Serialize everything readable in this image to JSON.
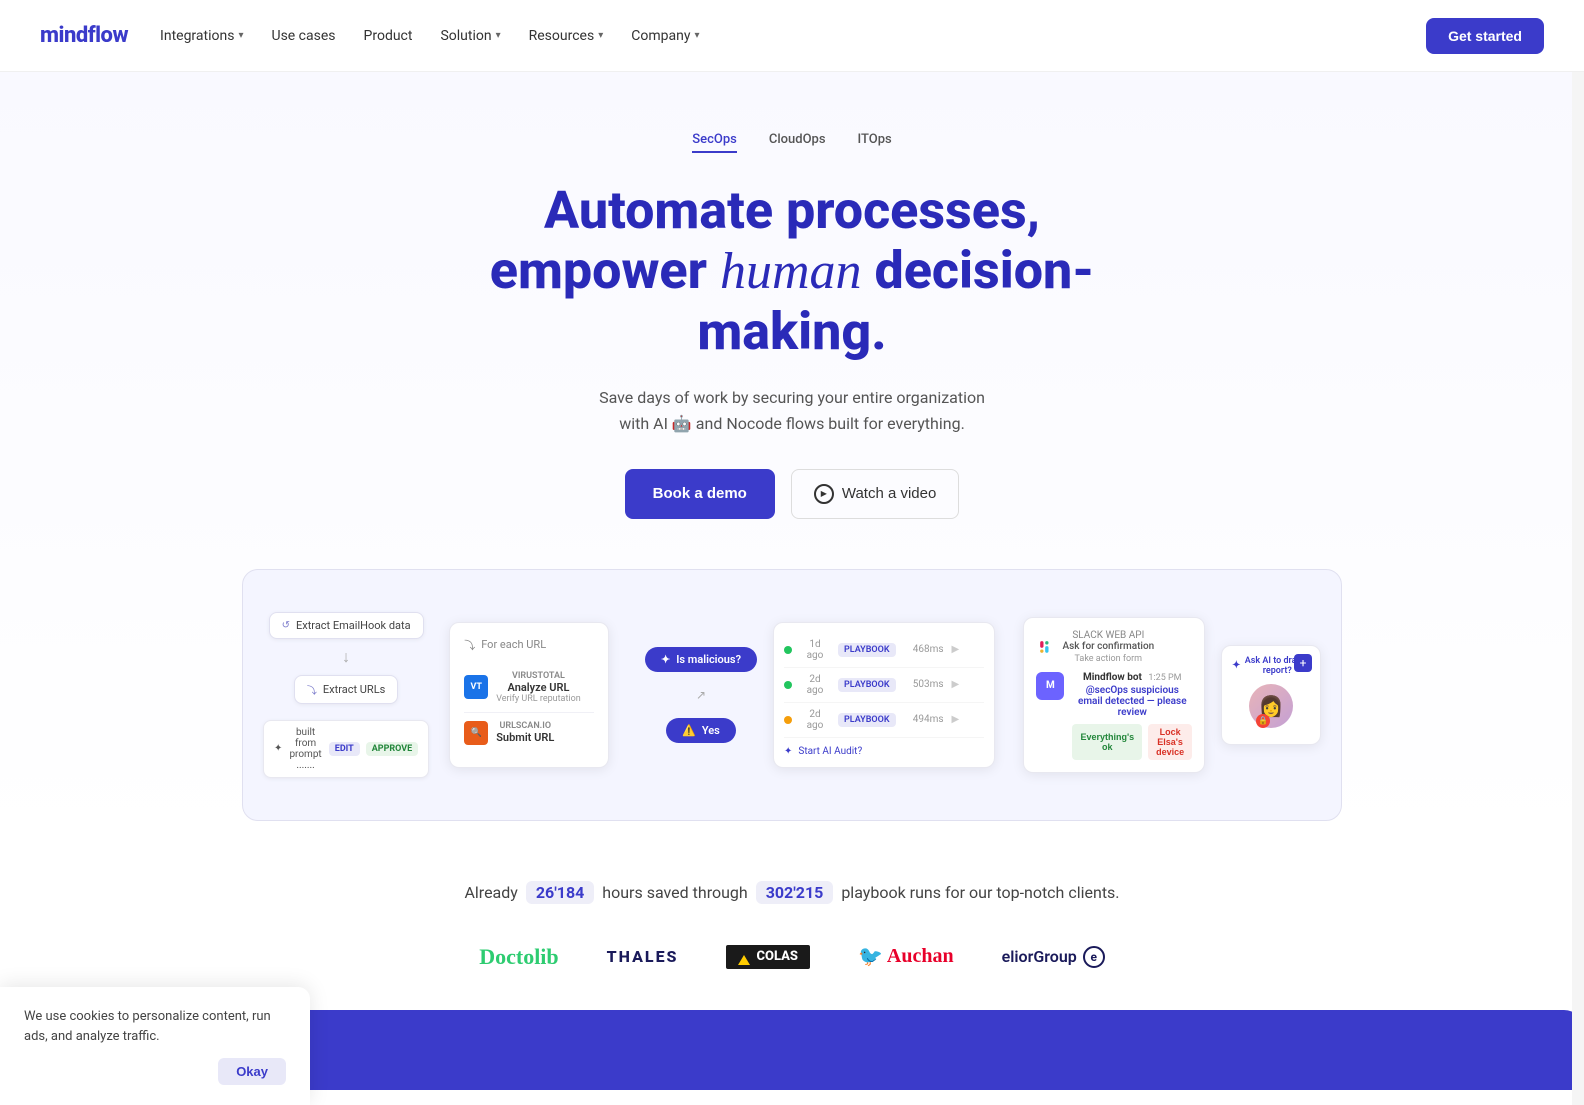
{
  "navbar": {
    "logo": "mindflow",
    "links": [
      {
        "label": "Integrations",
        "hasDropdown": true
      },
      {
        "label": "Use cases",
        "hasDropdown": false
      },
      {
        "label": "Product",
        "hasDropdown": false
      },
      {
        "label": "Solution",
        "hasDropdown": true
      },
      {
        "label": "Resources",
        "hasDropdown": true
      },
      {
        "label": "Company",
        "hasDropdown": true
      }
    ],
    "cta": "Get started"
  },
  "hero": {
    "tabs": [
      "SecOps",
      "CloudOps",
      "ITOps"
    ],
    "activeTab": 0,
    "title_line1": "Automate processes,",
    "title_line2_before": "empower ",
    "title_italic": "human",
    "title_line2_after": " decision-making.",
    "subtitle_line1": "Save days of work by securing your entire organization",
    "subtitle_line2": "with AI 🤖 and Nocode flows built for everything.",
    "cta_primary": "Book a demo",
    "cta_secondary": "Watch a video"
  },
  "demo": {
    "node1": "Extract EmailHook data",
    "node2": "Extract URLs",
    "card_title": "For each URL",
    "service1_tag": "VIRUSTOTAL",
    "service1_name": "Analyze URL",
    "service1_sub": "Verify URL reputation",
    "service2_tag": "URLSCAN.IO",
    "service2_name": "Submit URL",
    "decision1": "Is malicious?",
    "decision2": "Yes",
    "playbook_rows": [
      {
        "status": "ok",
        "time": "1d ago",
        "tag": "PLAYBOOK",
        "ms": "468ms"
      },
      {
        "status": "ok",
        "time": "2d ago",
        "tag": "PLAYBOOK",
        "ms": "503ms"
      },
      {
        "status": "warning",
        "time": "2d ago",
        "tag": "PLAYBOOK",
        "ms": "494ms"
      }
    ],
    "pb_footer": "Start AI Audit?",
    "slack_title": "SLACK WEB API",
    "slack_action": "Ask for confirmation",
    "slack_meta": "Take action form",
    "bot_name": "Mindflow bot",
    "bot_time": "1:25 PM",
    "bot_mention": "@secOps",
    "bot_text": "suspicious email detected — please review",
    "bot_btn1": "Everything's ok",
    "bot_btn2": "Lock Elsa's device",
    "ai_label": "Ask AI to draft a report?",
    "prompt_label": "built from prompt .......",
    "prompt_edit": "EDIT",
    "prompt_approve": "APPROVE"
  },
  "stats": {
    "prefix": "Already",
    "hours": "26'184",
    "middle": "hours saved through",
    "runs": "302'215",
    "suffix": "playbook runs for our top-notch clients."
  },
  "logos": [
    {
      "name": "Doctolib",
      "style": "doctolib"
    },
    {
      "name": "THALES",
      "style": "thales"
    },
    {
      "name": "COLAS",
      "style": "colas"
    },
    {
      "name": "Auchan",
      "style": "auchan"
    },
    {
      "name": "eliorGroup",
      "style": "eliorg"
    }
  ],
  "cookie": {
    "text": "We use cookies to personalize content, run ads, and analyze traffic.",
    "button": "Okay"
  }
}
